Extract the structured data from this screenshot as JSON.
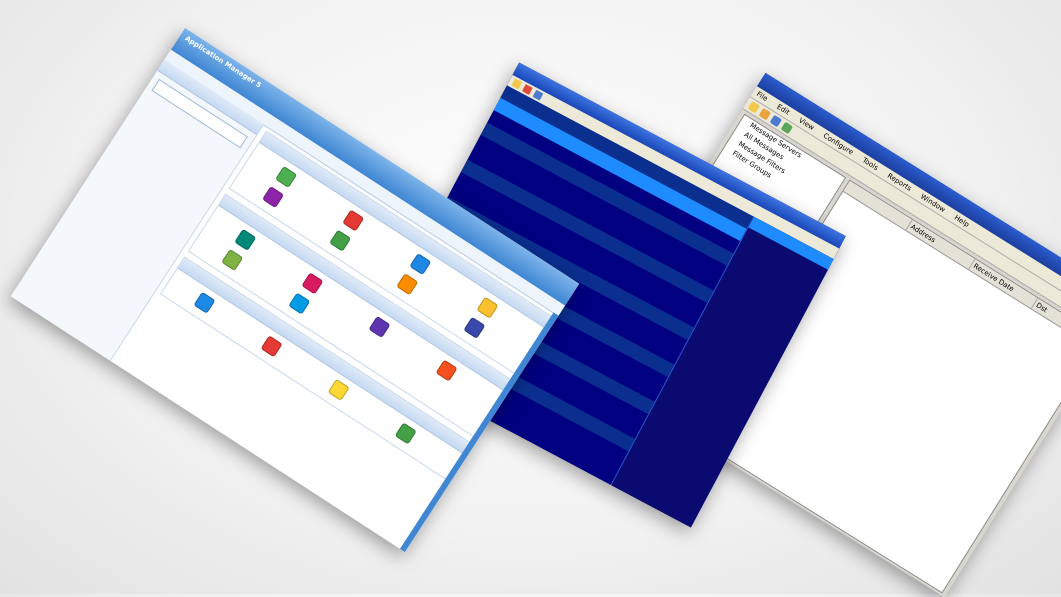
{
  "screens": {
    "ide": {
      "menu": [
        "File",
        "Edit",
        "View",
        "Configure",
        "Tools",
        "Reports",
        "Window",
        "Help"
      ],
      "tree": [
        "Message Servers",
        "All Messages",
        "Message Filters",
        "Filter Groups"
      ],
      "columns": [
        "",
        "Address",
        "Receive Date",
        "Dst"
      ]
    },
    "terminal": {
      "rows": [
        "",
        "",
        "",
        "",
        "",
        "",
        "",
        "",
        "",
        "",
        "",
        "",
        "",
        "",
        "",
        "",
        "",
        "",
        "",
        ""
      ],
      "side_rows": [
        "",
        "",
        "",
        "",
        "",
        ""
      ]
    },
    "webapp": {
      "brand_top": "",
      "brand_name": "Application Manager 5",
      "nav": [
        "",
        "",
        "",
        "",
        "",
        "",
        "",
        ""
      ],
      "panel_left_title": "",
      "tree": [
        "",
        "",
        "",
        "",
        "",
        "",
        "",
        "",
        "",
        "",
        ""
      ],
      "section_titles": [
        "",
        "",
        ""
      ],
      "icons_a": [
        {
          "label": "",
          "color": "#4caf50"
        },
        {
          "label": "",
          "color": "#e53935"
        },
        {
          "label": "",
          "color": "#1e88e5"
        },
        {
          "label": "",
          "color": "#fbc02d"
        },
        {
          "label": "",
          "color": "#8e24aa"
        },
        {
          "label": "",
          "color": "#43a047"
        },
        {
          "label": "",
          "color": "#fb8c00"
        },
        {
          "label": "",
          "color": "#3949ab"
        }
      ],
      "icons_b": [
        {
          "label": "",
          "color": "#00897b"
        },
        {
          "label": "",
          "color": "#d81b60"
        },
        {
          "label": "",
          "color": "#5e35b1"
        },
        {
          "label": "",
          "color": "#f4511e"
        },
        {
          "label": "",
          "color": "#7cb342"
        },
        {
          "label": "",
          "color": "#039be5"
        }
      ],
      "icons_c": [
        {
          "label": "",
          "color": "#1e88e5"
        },
        {
          "label": "",
          "color": "#e53935"
        },
        {
          "label": "",
          "color": "#fdd835"
        },
        {
          "label": "",
          "color": "#43a047"
        }
      ]
    }
  }
}
